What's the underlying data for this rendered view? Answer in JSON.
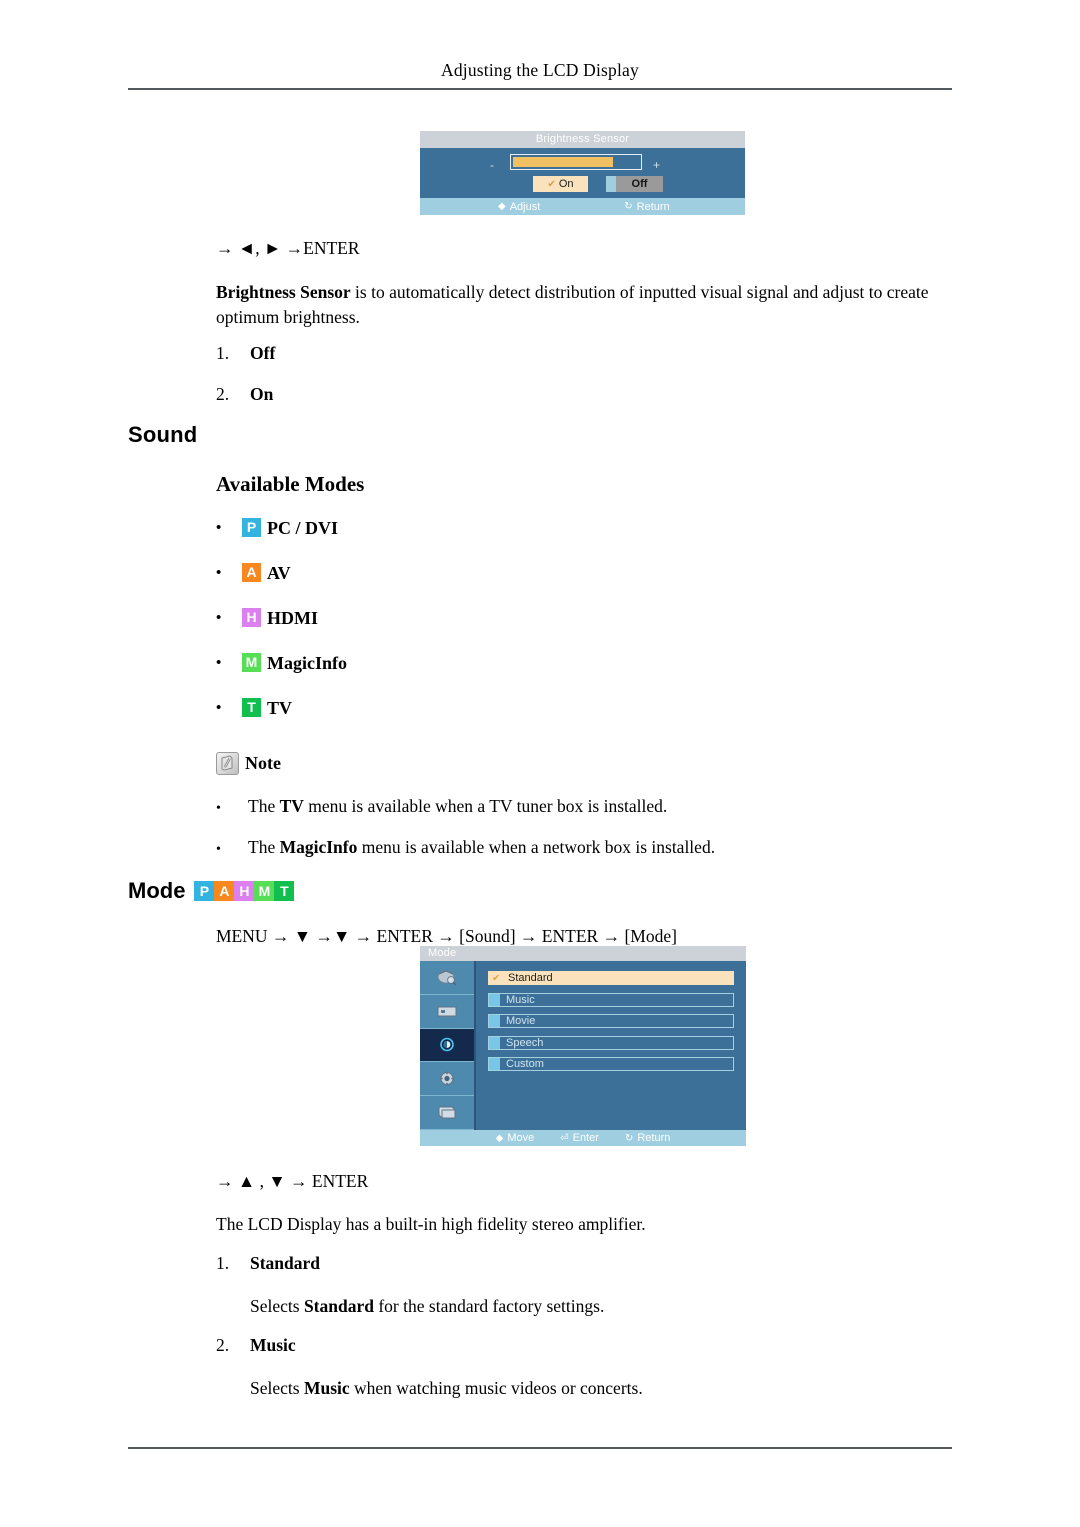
{
  "page": {
    "header_title": "Adjusting the LCD Display"
  },
  "brightness_section": {
    "osd": {
      "title": "Brightness Sensor",
      "minus_symbol": "-",
      "plus_symbol": "+",
      "slider_value_percent": 78,
      "on_label": "On",
      "off_label": "Off",
      "check_glyph": "✔",
      "footer": {
        "adjust_label": "Adjust",
        "return_label": "Return"
      },
      "colors": {
        "panel": "#3d7099",
        "title_bar": "#ccd2d8",
        "footer_bar": "#9fcee0",
        "slider_fill": "#f0c063",
        "highlight": "#fae3bc"
      }
    },
    "keypath": "→ ◄, ► →ENTER",
    "paragraph_bold": "Brightness Sensor",
    "paragraph_rest": " is to automatically detect distribution of inputted visual signal and adjust to create optimum brightness.",
    "items": [
      {
        "num": "1.",
        "label": "Off"
      },
      {
        "num": "2.",
        "label": "On"
      }
    ]
  },
  "sound_section": {
    "heading": "Sound",
    "available_modes_heading": "Available Modes",
    "bullet_glyph": "•",
    "modes": [
      {
        "badge": "P",
        "label": "PC / DVI",
        "color": "#33b3e0"
      },
      {
        "badge": "A",
        "label": "AV",
        "color": "#f6881f"
      },
      {
        "badge": "H",
        "label": "HDMI",
        "color": "#dd80ef"
      },
      {
        "badge": "M",
        "label": "MagicInfo",
        "color": "#56de56"
      },
      {
        "badge": "T",
        "label": "TV",
        "color": "#11bf4f"
      }
    ],
    "note": {
      "icon_label": "Note",
      "bullets": [
        {
          "pre": "The ",
          "bold": "TV",
          "post": " menu is available when a TV tuner box is installed."
        },
        {
          "pre": "The ",
          "bold": "MagicInfo",
          "post": " menu is available when a network box is installed."
        }
      ]
    }
  },
  "mode_section": {
    "heading": "Mode",
    "badges": [
      {
        "badge": "P",
        "color": "#33b3e0"
      },
      {
        "badge": "A",
        "color": "#f6881f"
      },
      {
        "badge": "H",
        "color": "#dd80ef"
      },
      {
        "badge": "M",
        "color": "#56de56"
      },
      {
        "badge": "T",
        "color": "#11bf4f"
      }
    ],
    "menu_path": "MENU → ▼ →▼ → ENTER → [Sound] → ENTER → [Mode]",
    "osd": {
      "title": "Mode",
      "items": [
        {
          "label": "Standard",
          "selected": true
        },
        {
          "label": "Music",
          "selected": false
        },
        {
          "label": "Movie",
          "selected": false
        },
        {
          "label": "Speech",
          "selected": false
        },
        {
          "label": "Custom",
          "selected": false
        }
      ],
      "sidebar_icons": [
        "picture-icon",
        "screen-icon",
        "sound-icon",
        "setup-icon",
        "multicontrol-icon"
      ],
      "active_sidebar_index": 2,
      "check_glyph": "✔",
      "footer": {
        "move_label": "Move",
        "enter_label": "Enter",
        "return_label": "Return"
      }
    },
    "keypath": "→ ▲ , ▼ → ENTER",
    "paragraph": "The LCD Display has a built-in high fidelity stereo amplifier.",
    "items": [
      {
        "num": "1.",
        "title": "Standard",
        "desc_pre": "Selects ",
        "desc_bold": "Standard",
        "desc_post": " for the standard factory settings."
      },
      {
        "num": "2.",
        "title": "Music",
        "desc_pre": "Selects ",
        "desc_bold": "Music",
        "desc_post": " when watching music videos or concerts."
      }
    ]
  }
}
